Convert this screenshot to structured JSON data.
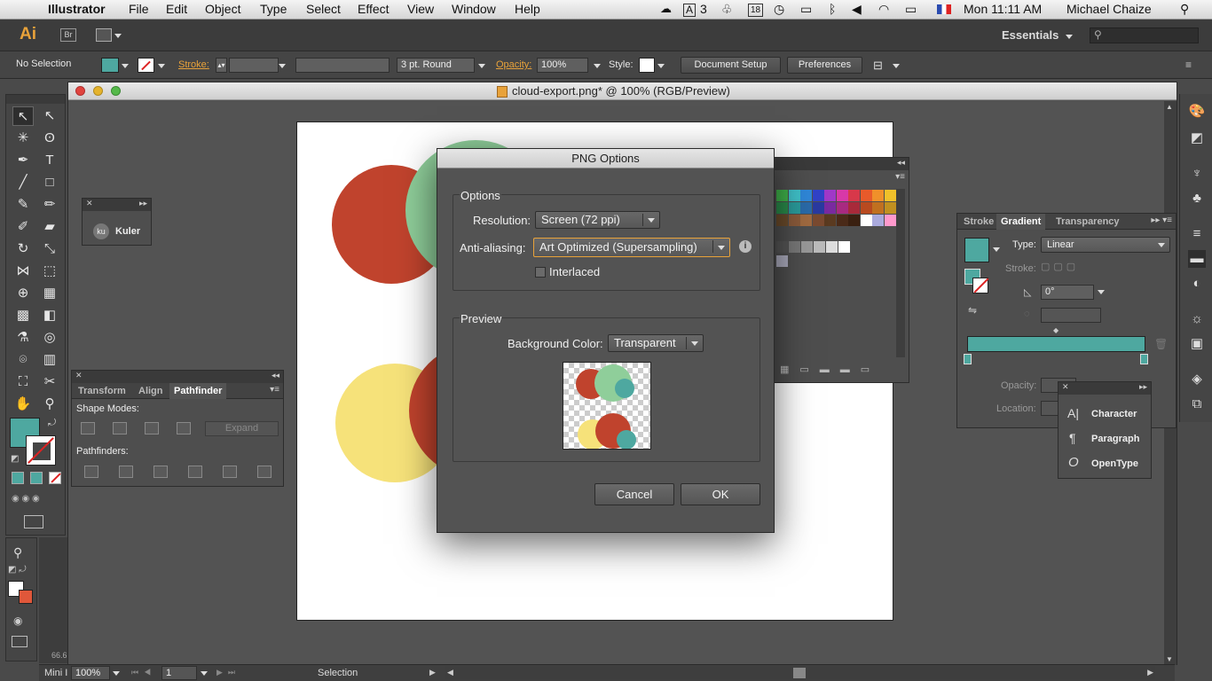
{
  "menubar": {
    "apple": "",
    "app": "Illustrator",
    "items": [
      "File",
      "Edit",
      "Object",
      "Type",
      "Select",
      "Effect",
      "View",
      "Window",
      "Help"
    ],
    "status": {
      "adobe_count": "3",
      "calendar": "18",
      "clock": "Mon 11:11 AM",
      "user": "Michael Chaize"
    }
  },
  "appbar": {
    "logo": "Ai",
    "bridge": "Br",
    "workspace": "Essentials"
  },
  "control": {
    "selection": "No Selection",
    "stroke_label": "Stroke:",
    "stroke_weight": "3 pt. Round",
    "opacity_label": "Opacity:",
    "opacity_value": "100%",
    "style_label": "Style:",
    "document_setup": "Document Setup",
    "preferences": "Preferences"
  },
  "document": {
    "title": "cloud-export.png* @ 100% (RGB/Preview)"
  },
  "kuler": {
    "badge": "ku",
    "label": "Kuler"
  },
  "pathfinder": {
    "tabs": [
      "Transform",
      "Align",
      "Pathfinder"
    ],
    "shape_modes": "Shape Modes:",
    "expand": "Expand",
    "pathfinders": "Pathfinders:"
  },
  "gradient_panel": {
    "tabs": [
      "Stroke",
      "Gradient",
      "Transparency"
    ],
    "type_label": "Type:",
    "type_value": "Linear",
    "stroke_label": "Stroke:",
    "angle": "0°",
    "opacity_label": "Opacity:",
    "location_label": "Location:"
  },
  "char_panel": {
    "items": [
      "Character",
      "Paragraph",
      "OpenType"
    ]
  },
  "dialog": {
    "title": "PNG Options",
    "options_group": "Options",
    "resolution_label": "Resolution:",
    "resolution_value": "Screen (72 ppi)",
    "antialias_label": "Anti-aliasing:",
    "antialias_value": "Art Optimized (Supersampling)",
    "interlaced_label": "Interlaced",
    "interlaced_checked": false,
    "preview_group": "Preview",
    "bg_label": "Background Color:",
    "bg_value": "Transparent",
    "cancel": "Cancel",
    "ok": "OK"
  },
  "status": {
    "zoom_small": "66.6",
    "mini": "Mini I",
    "zoom": "100%",
    "page": "1",
    "tool": "Selection"
  },
  "colors": {
    "teal": "#4ea8a0",
    "red": "#c0432d",
    "green": "#8fce9a",
    "yellow": "#f6e27a",
    "accent_orange": "#e8a23a"
  }
}
